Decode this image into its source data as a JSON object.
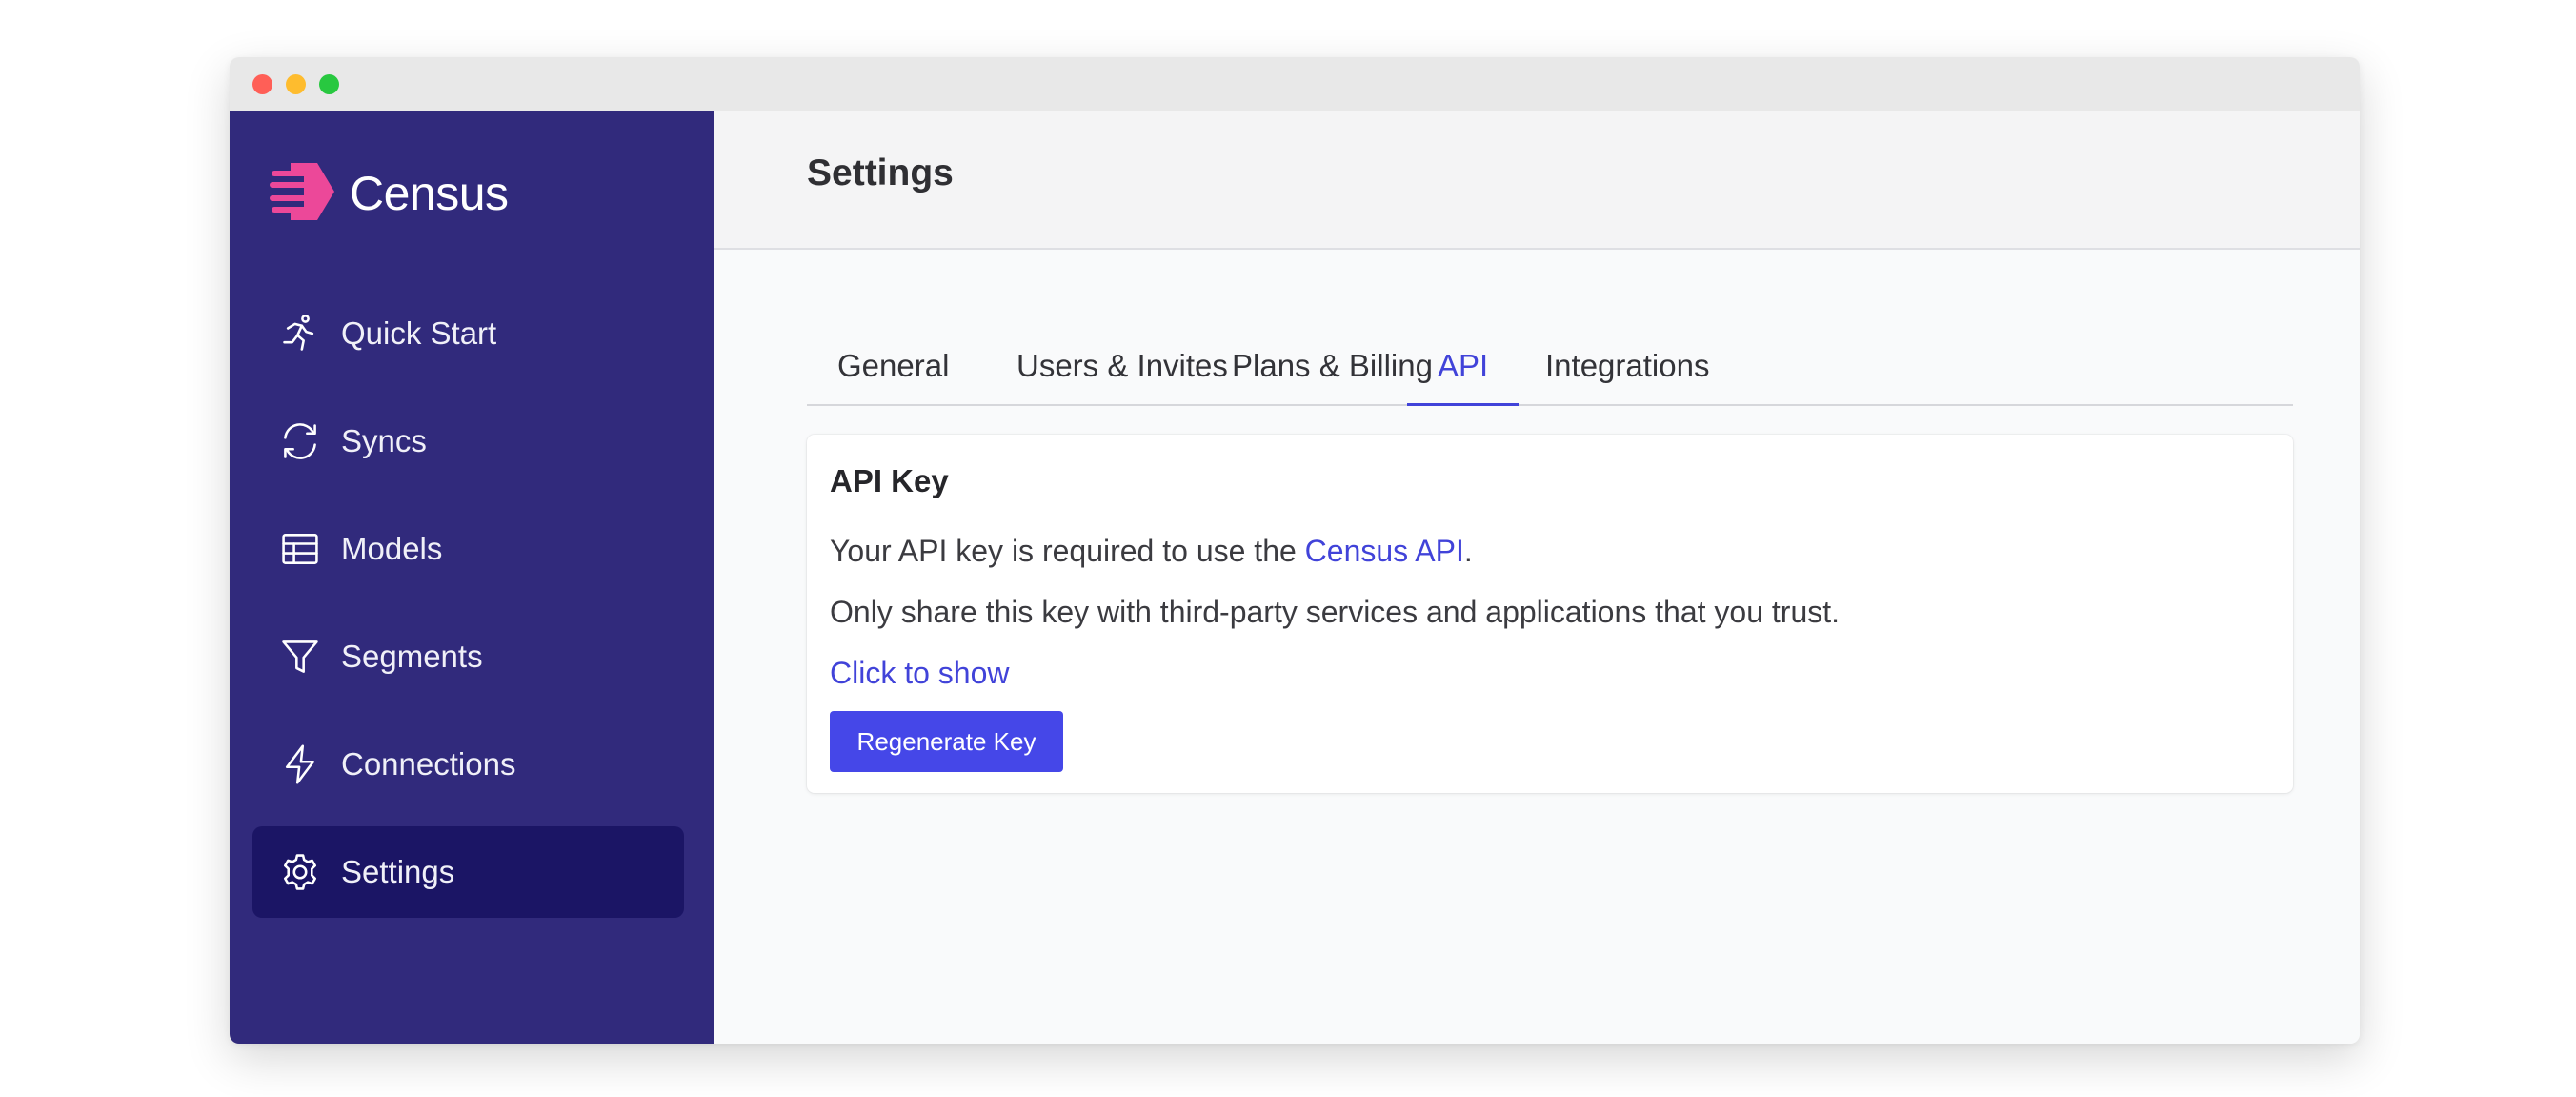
{
  "app": {
    "name": "Census"
  },
  "colors": {
    "sidebar_bg": "#312a7c",
    "sidebar_active": "#1b1565",
    "accent": "#4143d9",
    "button_bg": "#4547e8",
    "logo_pink": "#ec4899"
  },
  "sidebar": {
    "items": [
      {
        "label": "Quick Start",
        "icon": "running-person-icon",
        "active": false
      },
      {
        "label": "Syncs",
        "icon": "sync-icon",
        "active": false
      },
      {
        "label": "Models",
        "icon": "table-icon",
        "active": false
      },
      {
        "label": "Segments",
        "icon": "filter-icon",
        "active": false
      },
      {
        "label": "Connections",
        "icon": "lightning-icon",
        "active": false
      },
      {
        "label": "Settings",
        "icon": "gear-icon",
        "active": true
      }
    ]
  },
  "header": {
    "title": "Settings"
  },
  "tabs": [
    {
      "label": "General",
      "active": false
    },
    {
      "label": "Users & Invites",
      "active": false
    },
    {
      "label": "Plans & Billing",
      "active": false
    },
    {
      "label": "API",
      "active": true
    },
    {
      "label": "Integrations",
      "active": false
    }
  ],
  "api_card": {
    "title": "API Key",
    "line1_prefix": "Your API key is required to use the ",
    "line1_link": "Census API",
    "line1_suffix": ".",
    "line2": "Only share this key with third-party services and applications that you trust.",
    "show_link": "Click to show",
    "regenerate_button": "Regenerate Key"
  }
}
